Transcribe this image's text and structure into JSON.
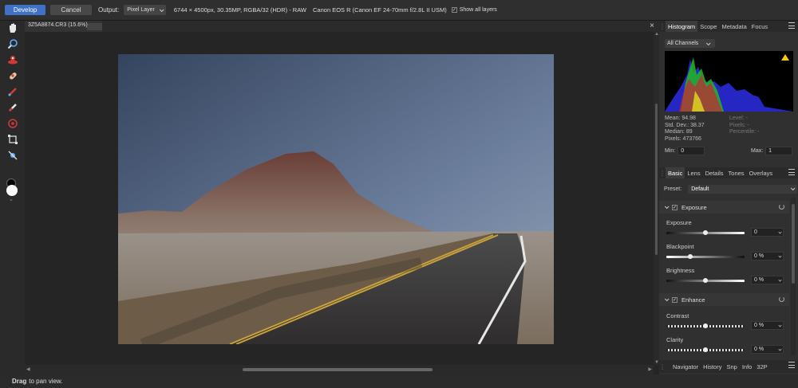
{
  "toolbar": {
    "develop_label": "Develop",
    "cancel_label": "Cancel",
    "output_label": "Output:",
    "output_value": "Pixel Layer",
    "image_info": "6744 × 4500px, 30.35MP, RGBA/32 (HDR) - RAW",
    "camera_info": "Canon EOS R (Canon EF 24-70mm f/2.8L II USM)",
    "show_all_layers_label": "Show all layers",
    "show_all_layers_checked": true
  },
  "document": {
    "title": "3Z5A8874.CR3 (15.6%)",
    "close_glyph": "×"
  },
  "tools": [
    "hand-icon",
    "zoom-icon",
    "red-eye-icon",
    "blemish-icon",
    "brush-icon",
    "eraser-icon",
    "target-icon",
    "crop-icon",
    "overlay-icon"
  ],
  "histogram_panel": {
    "tabs": [
      "Histogram",
      "Scope",
      "Metadata",
      "Focus"
    ],
    "active_tab": "Histogram",
    "channel": "All Channels",
    "stats_left": [
      "Mean: 94.98",
      "Std. Dev.: 38.37",
      "Median: 89",
      "Pixels: 473766"
    ],
    "stats_right": [
      "Level: -",
      "Pixels: -",
      "Percentile: -"
    ],
    "min_label": "Min:",
    "min_value": "0",
    "max_label": "Max:",
    "max_value": "1"
  },
  "develop_panel": {
    "tabs": [
      "Basic",
      "Lens",
      "Details",
      "Tones",
      "Overlays"
    ],
    "active_tab": "Basic",
    "preset_label": "Preset:",
    "preset_value": "Default",
    "exposure_section": {
      "title": "Exposure",
      "enabled": true,
      "sliders": [
        {
          "label": "Exposure",
          "value": "0"
        },
        {
          "label": "Blackpoint",
          "value": "0 %"
        },
        {
          "label": "Brightness",
          "value": "0 %"
        }
      ]
    },
    "enhance_section": {
      "title": "Enhance",
      "enabled": true,
      "sliders": [
        {
          "label": "Contrast",
          "value": "0 %"
        },
        {
          "label": "Clarity",
          "value": "0 %"
        }
      ]
    }
  },
  "bottom_panel": {
    "tabs": [
      "Navigator",
      "History",
      "Snp",
      "Info",
      "32P"
    ]
  },
  "status": {
    "bold": "Drag",
    "text": "to pan view."
  }
}
